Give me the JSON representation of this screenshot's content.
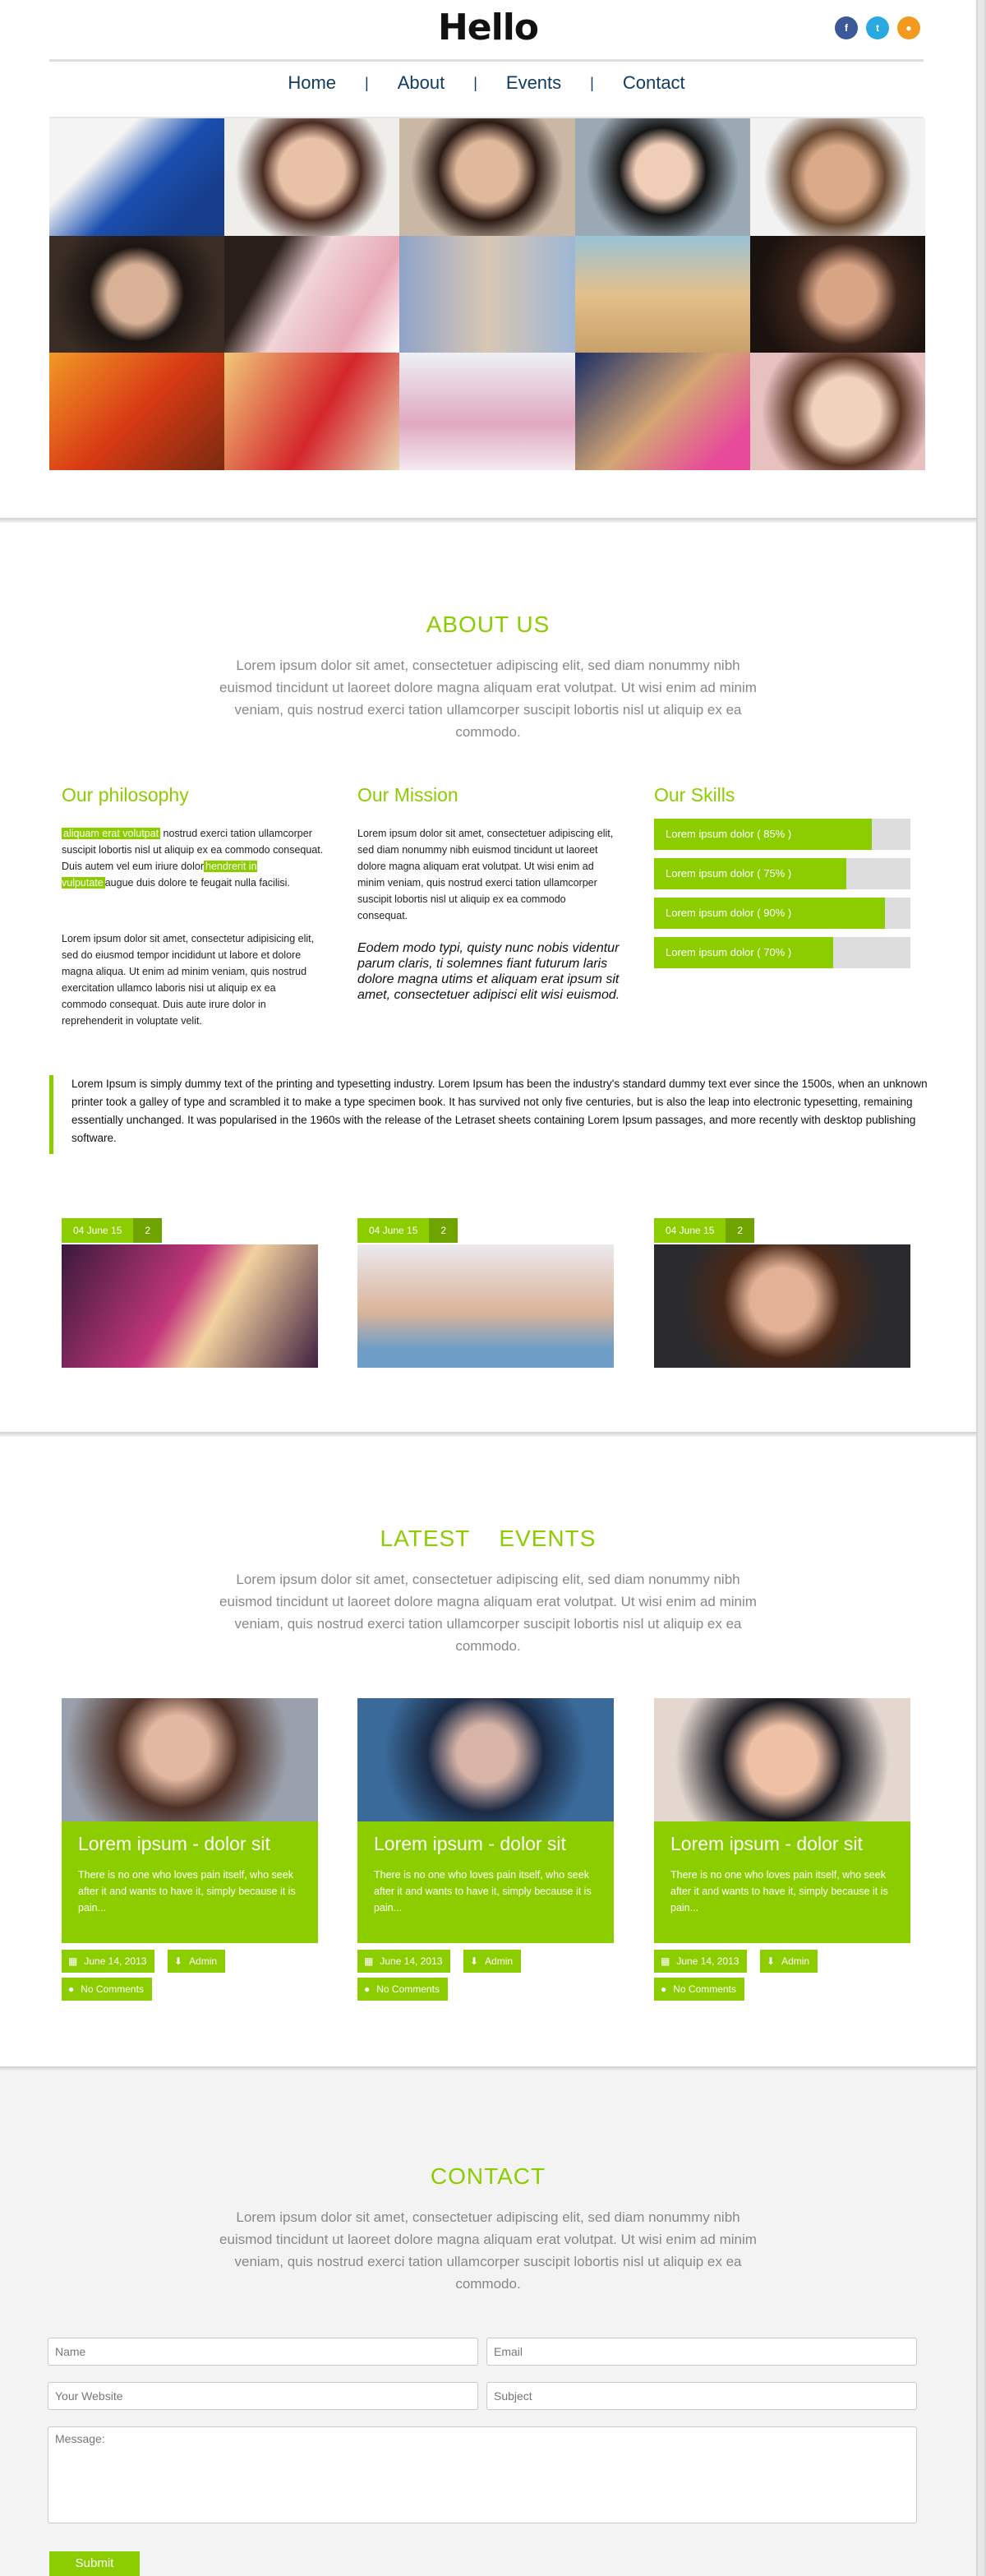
{
  "brand": {
    "logo": "Hello",
    "accent": "#8ccd00"
  },
  "social": [
    {
      "icon": "facebook-icon",
      "glyph": "f"
    },
    {
      "icon": "twitter-icon",
      "glyph": "t"
    },
    {
      "icon": "rss-icon",
      "glyph": "●"
    }
  ],
  "nav": {
    "home": "Home",
    "about": "About",
    "events": "Events",
    "contact": "Contact",
    "sep": "|"
  },
  "about": {
    "title": "ABOUT US",
    "lead": "Lorem ipsum dolor sit amet, consectetuer adipiscing elit, sed diam nonummy nibh euismod tincidunt ut laoreet dolore magna aliquam erat volutpat. Ut wisi enim ad minim veniam, quis nostrud exerci tation ullamcorper suscipit lobortis nisl ut aliquip ex ea commodo.",
    "philosophy": {
      "title": "Our philosophy",
      "hl1": "aliquam erat volutpat",
      "p1a": " nostrud exerci tation ullamcorper suscipit lobortis nisl ut aliquip ex ea commodo consequat. Duis autem vel eum iriure dolor",
      "hl2": "hendrerit in vulputate",
      "p1b": "augue duis dolore te feugait nulla facilisi.",
      "p2": "Lorem ipsum dolor sit amet, consectetur adipisicing elit, sed do eiusmod tempor incididunt ut labore et dolore magna aliqua. Ut enim ad minim veniam, quis nostrud exercitation ullamco laboris nisi ut aliquip ex ea commodo consequat. Duis aute irure dolor in reprehenderit in voluptate velit."
    },
    "mission": {
      "title": "Our Mission",
      "p1": "Lorem ipsum dolor sit amet, consectetuer adipiscing elit, sed diam nonummy nibh euismod tincidunt ut laoreet dolore magna aliquam erat volutpat. Ut wisi enim ad minim veniam, quis nostrud exerci tation ullamcorper suscipit lobortis nisl ut aliquip ex ea commodo consequat.",
      "italic": "Eodem modo typi, quisty nunc nobis videntur parum claris, ti solemnes fiant futurum laris dolore magna utims et aliquam erat ipsum sit amet, consectetuer adipisci elit wisi euismod."
    },
    "skills": {
      "title": "Our Skills",
      "items": [
        {
          "label": "Lorem ipsum dolor ( 85% )",
          "value": 0.85
        },
        {
          "label": "Lorem ipsum dolor ( 75% )",
          "value": 0.75
        },
        {
          "label": "Lorem ipsum dolor ( 90% )",
          "value": 0.9
        },
        {
          "label": "Lorem ipsum dolor ( 70% )",
          "value": 0.7
        }
      ]
    },
    "quote": "Lorem Ipsum is simply dummy text of the printing and typesetting industry. Lorem Ipsum has been the industry's standard dummy text ever since the 1500s, when an unknown printer took a galley of type and scrambled it to make a type specimen book. It has survived not only five centuries, but is also the leap into electronic typesetting, remaining essentially unchanged. It was popularised in the 1960s with the release of the Letraset sheets containing Lorem Ipsum passages, and more recently with desktop publishing software.",
    "posts": [
      {
        "date": "04 June 15",
        "count": "2"
      },
      {
        "date": "04 June 15",
        "count": "2"
      },
      {
        "date": "04 June 15",
        "count": "2"
      }
    ]
  },
  "events": {
    "title_a": "LATEST",
    "title_b": "EVENTS",
    "lead": "Lorem ipsum dolor sit amet, consectetuer adipiscing elit, sed diam nonummy nibh euismod tincidunt ut laoreet dolore magna aliquam erat volutpat. Ut wisi enim ad minim veniam, quis nostrud exerci tation ullamcorper suscipit lobortis nisl ut aliquip ex ea commodo.",
    "items": [
      {
        "title": "Lorem ipsum - dolor sit",
        "desc": "There is no one who loves pain itself, who seek after it and wants to have it, simply because it is pain...",
        "date": "June 14, 2013",
        "author": "Admin",
        "comments": "No Comments"
      },
      {
        "title": "Lorem ipsum - dolor sit",
        "desc": "There is no one who loves pain itself, who seek after it and wants to have it, simply because it is pain...",
        "date": "June 14, 2013",
        "author": "Admin",
        "comments": "No Comments"
      },
      {
        "title": "Lorem ipsum - dolor sit",
        "desc": "There is no one who loves pain itself, who seek after it and wants to have it, simply because it is pain...",
        "date": "June 14, 2013",
        "author": "Admin",
        "comments": "No Comments"
      }
    ]
  },
  "contact": {
    "title": "CONTACT",
    "lead": "Lorem ipsum dolor sit amet, consectetuer adipiscing elit, sed diam nonummy nibh euismod tincidunt ut laoreet dolore magna aliquam erat volutpat. Ut wisi enim ad minim veniam, quis nostrud exerci tation ullamcorper suscipit lobortis nisl ut aliquip ex ea commodo.",
    "name_ph": "Name",
    "email_ph": "Email",
    "website_ph": "Your Website",
    "subject_ph": "Subject",
    "message_ph": "Message:",
    "submit": "Submit"
  }
}
